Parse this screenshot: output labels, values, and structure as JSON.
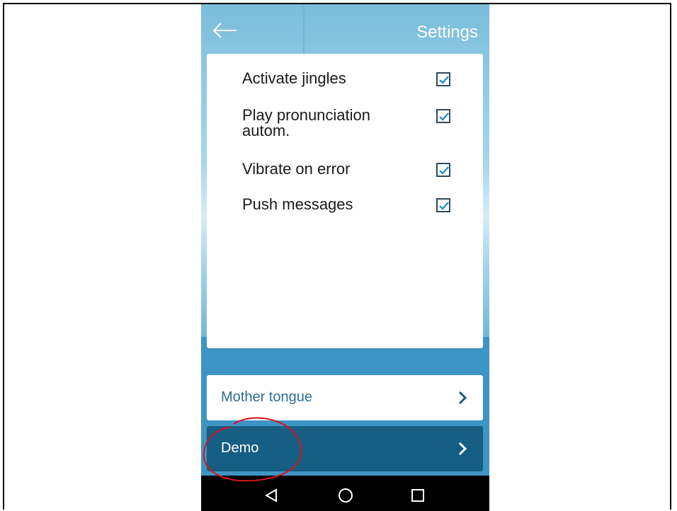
{
  "header": {
    "title": "Settings",
    "back_icon": "arrow-left-icon"
  },
  "settings": [
    {
      "label": "Activate jingles",
      "checked": true
    },
    {
      "label": "Play pronunciation autom.",
      "checked": true
    },
    {
      "label": "Vibrate on error",
      "checked": true
    },
    {
      "label": "Push messages",
      "checked": true
    }
  ],
  "menu": [
    {
      "label": "Mother tongue",
      "icon": "chevron-right-icon"
    },
    {
      "label": "Demo",
      "icon": "chevron-right-icon"
    }
  ],
  "android_nav": [
    "back-triangle-icon",
    "home-circle-icon",
    "recents-square-icon"
  ],
  "colors": {
    "accent_dark": "#165e84",
    "accent_text": "#2d6e94",
    "checkbox_border": "#2f4a5a",
    "annotation": "#d9141b"
  }
}
